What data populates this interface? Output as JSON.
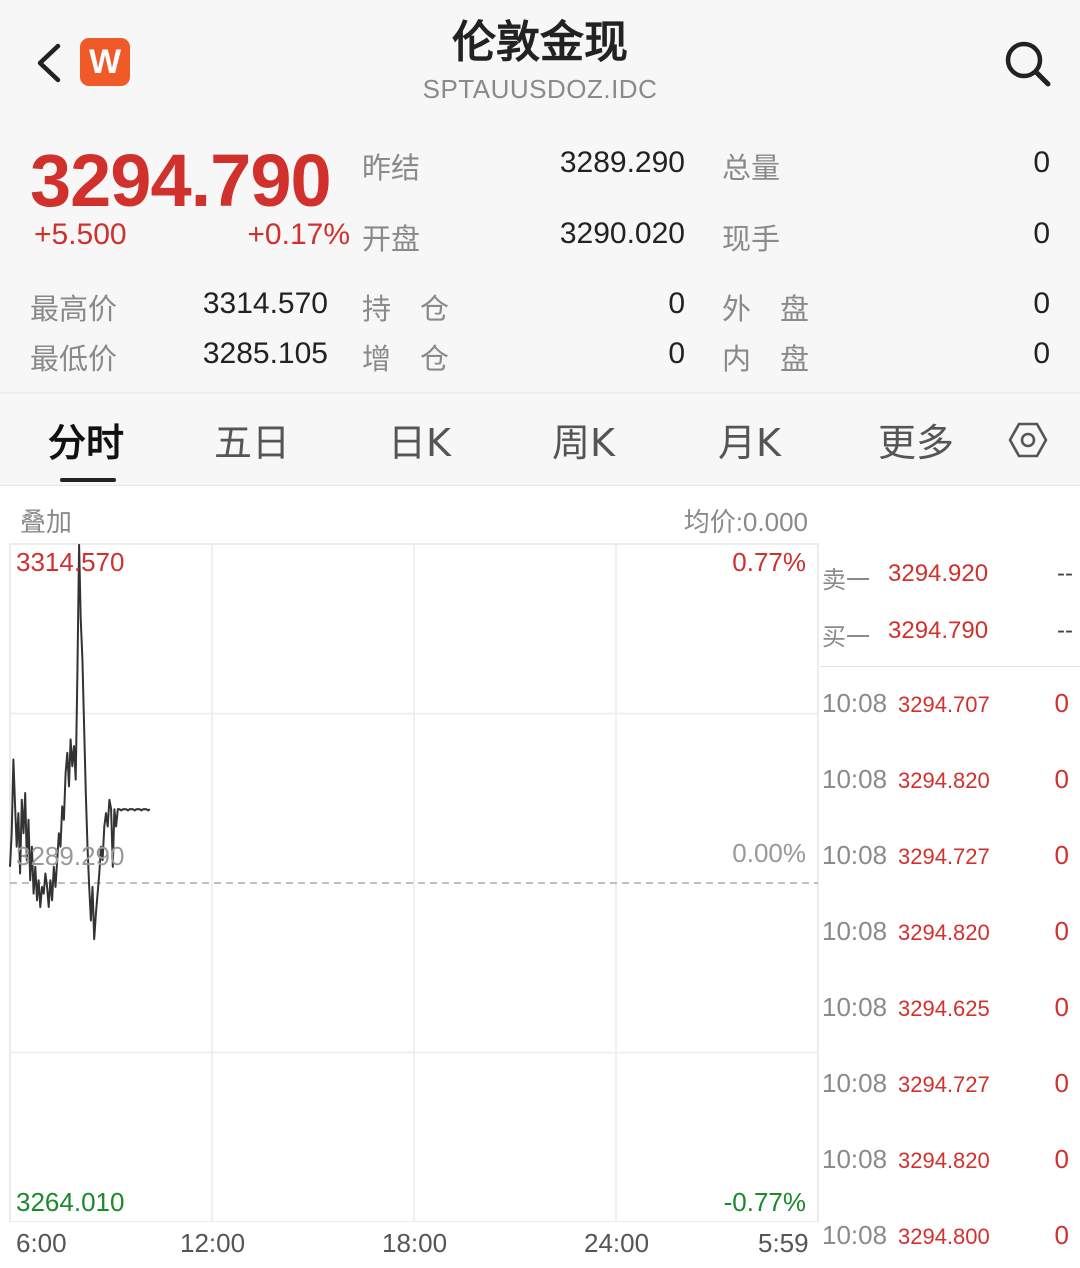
{
  "header": {
    "title": "伦敦金现",
    "symbol": "SPTAUUSDOZ.IDC",
    "logo_text": "W",
    "logo_color": "#f05a28",
    "back_icon": "chevron-left-icon",
    "search_icon": "search-icon"
  },
  "quote": {
    "price": "3294.790",
    "change": "+5.500",
    "change_pct": "+0.17%",
    "color_up": "#d0312d",
    "color_down": "#1a8a2a",
    "stats": {
      "prev_settle_label": "昨结",
      "prev_settle": "3289.290",
      "open_label": "开盘",
      "open": "3290.020",
      "total_vol_label": "总量",
      "total_vol": "0",
      "cur_vol_label": "现手",
      "cur_vol": "0",
      "high_label": "最高价",
      "high": "3314.570",
      "low_label": "最低价",
      "low": "3285.105",
      "hold_label": "持　仓",
      "hold": "0",
      "add_label": "增　仓",
      "add": "0",
      "outer_label": "外　盘",
      "outer": "0",
      "inner_label": "内　盘",
      "inner": "0"
    }
  },
  "tabs": [
    "分时",
    "五日",
    "日K",
    "周K",
    "月K",
    "更多"
  ],
  "active_tab": "分时",
  "chart_panel": {
    "overlay_label": "叠加",
    "avg_label": "均价:0.000",
    "top_price": "3314.570",
    "mid_price": "3289.290",
    "bottom_price": "3264.010",
    "top_pct": "0.77%",
    "mid_pct": "0.00%",
    "bottom_pct": "-0.77%",
    "time_axis": [
      "6:00",
      "12:00",
      "18:00",
      "24:00",
      "5:59"
    ]
  },
  "chart_data": {
    "type": "line",
    "xlabel": "",
    "ylabel": "",
    "xlim_minutes": [
      0,
      1439
    ],
    "ylim": [
      3264.01,
      3314.57
    ],
    "reference_price": 3289.29,
    "x_ticks": [
      "6:00",
      "12:00",
      "18:00",
      "24:00",
      "5:59"
    ],
    "series": [
      {
        "x": [
          0,
          3,
          6,
          9,
          12,
          15,
          18,
          21,
          24,
          27,
          30,
          33,
          36,
          39,
          42,
          45,
          48,
          51,
          54,
          57,
          60,
          63,
          66,
          69,
          72,
          75,
          78,
          81,
          84,
          87,
          90,
          93,
          96,
          99,
          102,
          105,
          108,
          111,
          114,
          117,
          120,
          123,
          126,
          129,
          132,
          135,
          138,
          141,
          144,
          147,
          150,
          153,
          156,
          159,
          162,
          165,
          168,
          171,
          174,
          177,
          180,
          183,
          186,
          189,
          192,
          195,
          198,
          201,
          204,
          207,
          210,
          213,
          216,
          219,
          222,
          225,
          228,
          231,
          234,
          237,
          240,
          243,
          246,
          249
        ],
        "y": [
          3290.5,
          3293.0,
          3298.5,
          3295.0,
          3292.0,
          3294.5,
          3290.0,
          3295.5,
          3293.0,
          3296.0,
          3291.0,
          3294.0,
          3289.5,
          3292.0,
          3288.5,
          3290.5,
          3288.0,
          3289.5,
          3287.5,
          3289.0,
          3288.5,
          3290.0,
          3289.0,
          3287.5,
          3289.5,
          3288.0,
          3290.5,
          3289.0,
          3291.0,
          3293.0,
          3292.0,
          3295.0,
          3294.0,
          3297.5,
          3299.0,
          3296.5,
          3300.0,
          3298.0,
          3299.5,
          3297.0,
          3305.0,
          3314.5,
          3309.0,
          3306.0,
          3301.0,
          3296.0,
          3292.0,
          3289.0,
          3286.5,
          3289.0,
          3285.1,
          3287.0,
          3288.5,
          3290.0,
          3292.0,
          3291.0,
          3293.5,
          3294.5,
          3293.5,
          3295.5,
          3294.8,
          3290.5,
          3294.79,
          3293.5,
          3294.8,
          3294.79,
          3294.7,
          3294.79,
          3294.8,
          3294.79,
          3294.7,
          3294.79,
          3294.8,
          3294.79,
          3294.7,
          3294.79,
          3294.8,
          3294.79,
          3294.7,
          3294.79,
          3294.8,
          3294.79,
          3294.7,
          3294.79
        ]
      }
    ]
  },
  "order_book": {
    "ask_label": "卖一",
    "ask_price": "3294.920",
    "ask_vol": "--",
    "bid_label": "买一",
    "bid_price": "3294.790",
    "bid_vol": "--"
  },
  "trades": [
    {
      "time": "10:08",
      "price": "3294.707",
      "vol": "0"
    },
    {
      "time": "10:08",
      "price": "3294.820",
      "vol": "0"
    },
    {
      "time": "10:08",
      "price": "3294.727",
      "vol": "0"
    },
    {
      "time": "10:08",
      "price": "3294.820",
      "vol": "0"
    },
    {
      "time": "10:08",
      "price": "3294.625",
      "vol": "0"
    },
    {
      "time": "10:08",
      "price": "3294.727",
      "vol": "0"
    },
    {
      "time": "10:08",
      "price": "3294.820",
      "vol": "0"
    },
    {
      "time": "10:08",
      "price": "3294.800",
      "vol": "0"
    }
  ]
}
